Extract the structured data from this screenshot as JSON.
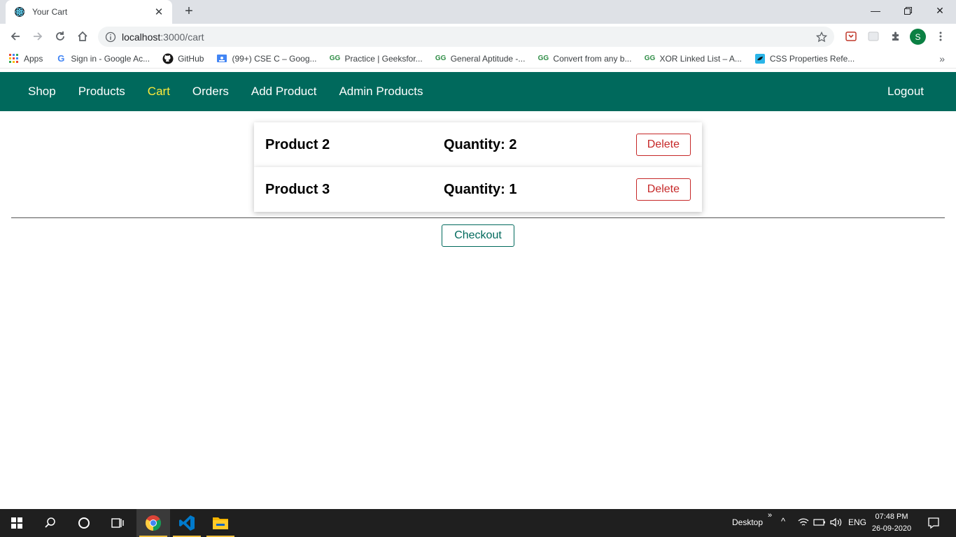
{
  "browser": {
    "tab_title": "Your Cart",
    "url_host": "localhost",
    "url_rest": ":3000/cart",
    "profile_initial": "S",
    "bookmarks": [
      {
        "label": "Apps",
        "icon": "apps-grid-icon"
      },
      {
        "label": "Sign in - Google Ac...",
        "icon": "google-icon"
      },
      {
        "label": "GitHub",
        "icon": "github-icon"
      },
      {
        "label": "(99+) CSE C – Goog...",
        "icon": "google-classroom-icon"
      },
      {
        "label": "Practice | Geeksfor...",
        "icon": "geeksforgeeks-icon"
      },
      {
        "label": "General Aptitude -...",
        "icon": "geeksforgeeks-icon"
      },
      {
        "label": "Convert from any b...",
        "icon": "geeksforgeeks-icon"
      },
      {
        "label": "XOR Linked List – A...",
        "icon": "geeksforgeeks-icon"
      },
      {
        "label": "CSS Properties Refe...",
        "icon": "css-reference-icon"
      }
    ]
  },
  "header": {
    "nav": [
      "Shop",
      "Products",
      "Cart",
      "Orders",
      "Add Product",
      "Admin Products"
    ],
    "active": "Cart",
    "logout": "Logout"
  },
  "cart": {
    "items": [
      {
        "name": "Product 2",
        "quantity": "Quantity: 2",
        "delete_label": "Delete"
      },
      {
        "name": "Product 3",
        "quantity": "Quantity: 1",
        "delete_label": "Delete"
      }
    ],
    "checkout_label": "Checkout"
  },
  "taskbar": {
    "desktop_label": "Desktop",
    "language": "ENG",
    "time": "07:48 PM",
    "date": "26-09-2020"
  },
  "colors": {
    "header_bg": "#00695c",
    "active_nav": "#ffeb3b",
    "danger": "#c62828"
  }
}
